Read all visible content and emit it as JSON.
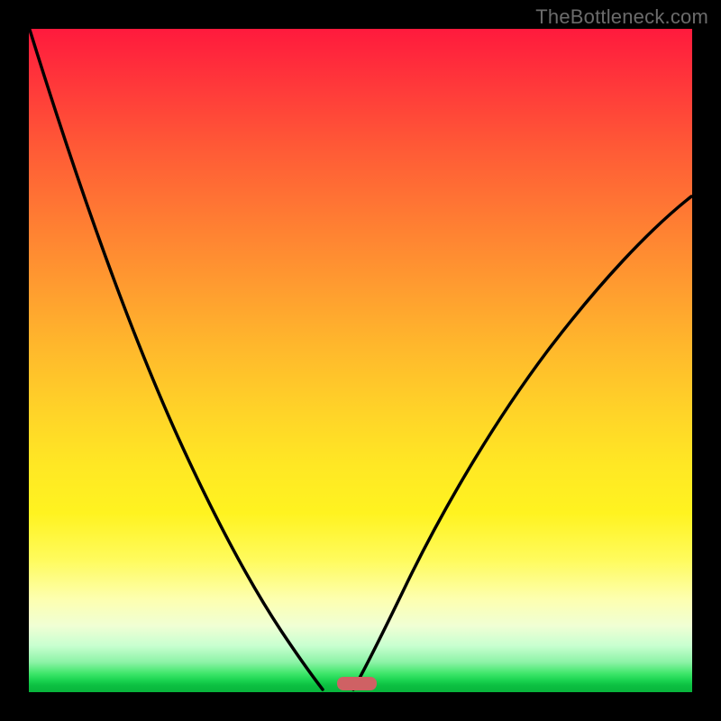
{
  "watermark": "TheBottleneck.com",
  "chart_data": {
    "type": "line",
    "title": "",
    "xlabel": "",
    "ylabel": "",
    "xlim": [
      0,
      1
    ],
    "ylim": [
      0,
      1
    ],
    "gradient": {
      "direction": "vertical",
      "stops": [
        {
          "pos": 0.0,
          "color": "#ff1a3d"
        },
        {
          "pos": 0.5,
          "color": "#ffd428"
        },
        {
          "pos": 0.85,
          "color": "#fdffb0"
        },
        {
          "pos": 1.0,
          "color": "#08b53c"
        }
      ]
    },
    "series": [
      {
        "name": "left-curve",
        "x": [
          0.0,
          0.05,
          0.1,
          0.15,
          0.2,
          0.25,
          0.3,
          0.35,
          0.38,
          0.4,
          0.42,
          0.44
        ],
        "y": [
          1.0,
          0.86,
          0.73,
          0.61,
          0.5,
          0.39,
          0.28,
          0.17,
          0.1,
          0.05,
          0.018,
          0.0
        ]
      },
      {
        "name": "right-curve",
        "x": [
          0.49,
          0.52,
          0.56,
          0.61,
          0.68,
          0.76,
          0.84,
          0.92,
          1.0
        ],
        "y": [
          0.0,
          0.04,
          0.11,
          0.2,
          0.32,
          0.45,
          0.56,
          0.66,
          0.745
        ]
      }
    ],
    "marker": {
      "x": 0.465,
      "y": 0.0,
      "color": "#cf6164"
    },
    "annotations": []
  },
  "colors": {
    "curve": "#000000",
    "marker": "#cf6164"
  }
}
